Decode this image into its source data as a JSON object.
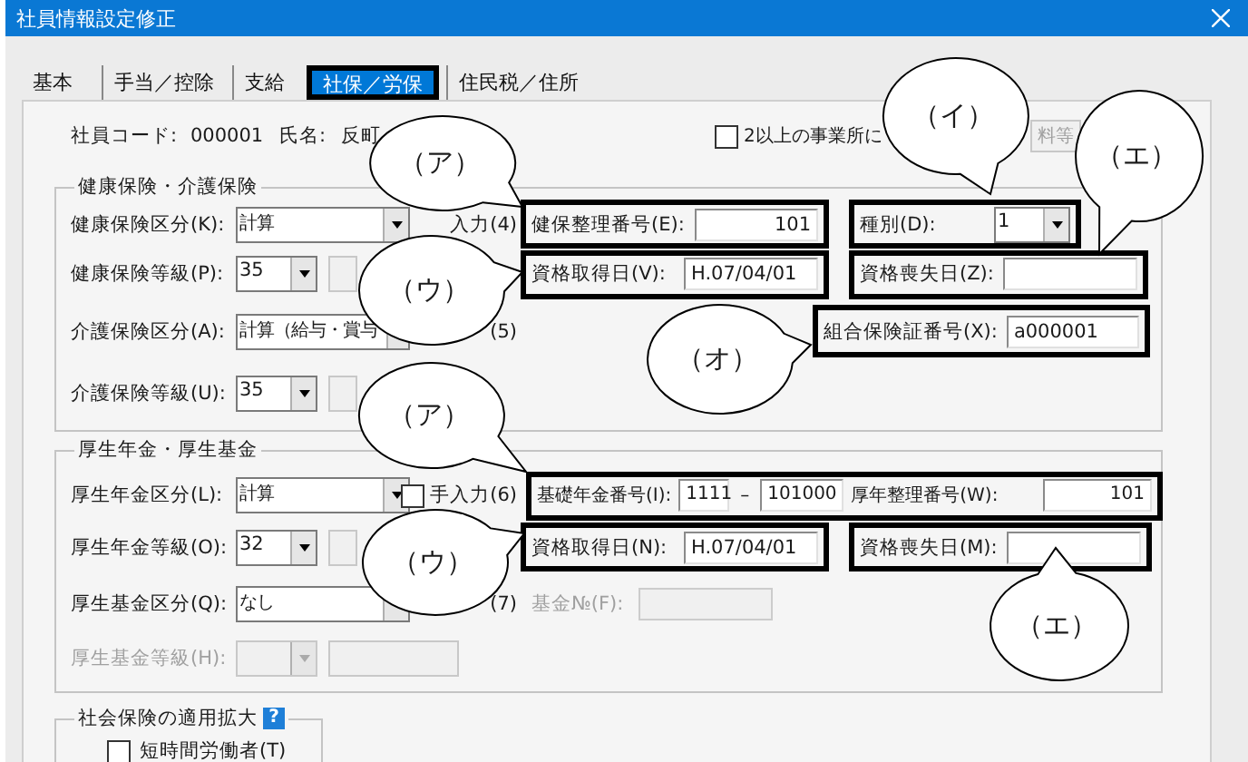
{
  "window": {
    "title": "社員情報設定修正"
  },
  "tabs": [
    {
      "label": "基本",
      "selected": false
    },
    {
      "label": "手当／控除",
      "selected": false
    },
    {
      "label": "支給",
      "selected": false
    },
    {
      "label": "社保／労保",
      "selected": true
    },
    {
      "label": "住民税／住所",
      "selected": false
    }
  ],
  "employee": {
    "code_label": "社員コード:",
    "code": "000001",
    "name_label": "氏名:",
    "name": "反町"
  },
  "multi_office": {
    "label": "2以上の事業所に",
    "checked": false
  },
  "premium_button": {
    "label": "料等",
    "disabled": true
  },
  "groups": [
    {
      "title": "健康保険・介護保険",
      "rows": [
        {
          "label": {
            "text": "健康保険区分(K):",
            "disabled": false
          },
          "control": {
            "kind": "combo",
            "value": "計算",
            "disabled": false
          },
          "extra": {
            "kind": "note",
            "text": "入力(4)"
          },
          "middle": {
            "kind": "frame",
            "items": [
              {
                "kind": "label",
                "text": "健保整理番号(E):"
              },
              {
                "kind": "number",
                "value": "101"
              }
            ]
          },
          "right": {
            "kind": "frame",
            "items": [
              {
                "kind": "label",
                "text": "種別(D):"
              },
              {
                "kind": "combo",
                "value": "1"
              }
            ]
          }
        },
        {
          "label": {
            "text": "健康保険等級(P):",
            "disabled": false
          },
          "control": {
            "kind": "grade",
            "value": "35",
            "disabled": false
          },
          "extra": {
            "kind": "box"
          },
          "middle": {
            "kind": "frame",
            "items": [
              {
                "kind": "label",
                "text": "資格取得日(V):"
              },
              {
                "kind": "text",
                "value": "H.07/04/01"
              }
            ]
          },
          "right": {
            "kind": "frame",
            "items": [
              {
                "kind": "label",
                "text": "資格喪失日(Z):"
              },
              {
                "kind": "text"
              }
            ]
          }
        },
        {
          "label": {
            "text": "介護保険区分(A):",
            "disabled": false
          },
          "control": {
            "kind": "combo",
            "value": "計算（給与・賞与",
            "disabled": false
          },
          "extra": {
            "kind": "note",
            "text": "(5)"
          },
          "right": {
            "kind": "frame",
            "items": [
              {
                "kind": "label",
                "text": "組合保険証番号(X):"
              },
              {
                "kind": "text",
                "value": "a000001"
              }
            ]
          }
        },
        {
          "label": {
            "text": "介護保険等級(U):",
            "disabled": false
          },
          "control": {
            "kind": "grade",
            "value": "35",
            "disabled": false
          },
          "extra": {
            "kind": "box"
          }
        }
      ]
    },
    {
      "title": "厚生年金・厚生基金",
      "rows": [
        {
          "label": {
            "text": "厚生年金区分(L):",
            "disabled": false
          },
          "control": {
            "kind": "combo",
            "value": "計算",
            "disabled": false
          },
          "extra": {
            "kind": "check_note",
            "text": "手入力(6)",
            "checked": false
          },
          "wide": {
            "kind": "frame",
            "items": [
              {
                "kind": "label",
                "text": "基礎年金番号(I):"
              },
              {
                "kind": "number",
                "value": "1111"
              },
              {
                "kind": "dash",
                "text": "–"
              },
              {
                "kind": "number",
                "value": "101000"
              },
              {
                "kind": "label",
                "text": "厚年整理番号(W):"
              },
              {
                "kind": "number",
                "value": "101"
              }
            ]
          }
        },
        {
          "label": {
            "text": "厚生年金等級(O):",
            "disabled": false
          },
          "control": {
            "kind": "grade",
            "value": "32",
            "disabled": false
          },
          "extra": {
            "kind": "box"
          },
          "middle": {
            "kind": "frame",
            "items": [
              {
                "kind": "label",
                "text": "資格取得日(N):"
              },
              {
                "kind": "text",
                "value": "H.07/04/01"
              }
            ]
          },
          "right": {
            "kind": "frame",
            "items": [
              {
                "kind": "label",
                "text": "資格喪失日(M):"
              },
              {
                "kind": "text"
              }
            ]
          }
        },
        {
          "label": {
            "text": "厚生基金区分(Q):",
            "disabled": false
          },
          "control": {
            "kind": "combo",
            "value": "なし",
            "disabled": false
          },
          "extra": {
            "kind": "note",
            "text": "(7)"
          },
          "middle": {
            "kind": "plain",
            "items": [
              {
                "kind": "label",
                "text": "基金№(F):",
                "disabled": true
              },
              {
                "kind": "text",
                "disabled": true
              }
            ]
          }
        },
        {
          "label": {
            "text": "厚生基金等級(H):",
            "disabled": true
          },
          "control": {
            "kind": "grade",
            "disabled": true
          },
          "extra": {
            "kind": "box"
          }
        }
      ]
    }
  ],
  "extension": {
    "title": "社会保険の適用拡大",
    "help": "?",
    "checks": [
      {
        "label": "短時間労働者(T)",
        "checked": false
      }
    ]
  },
  "callouts": [
    {
      "label": "（イ）"
    },
    {
      "label": "（エ）"
    },
    {
      "label": "（ア）"
    },
    {
      "label": "（ウ）"
    },
    {
      "label": "（オ）"
    },
    {
      "label": "（ア）"
    },
    {
      "label": "（ウ）"
    },
    {
      "label": "（エ）"
    }
  ]
}
